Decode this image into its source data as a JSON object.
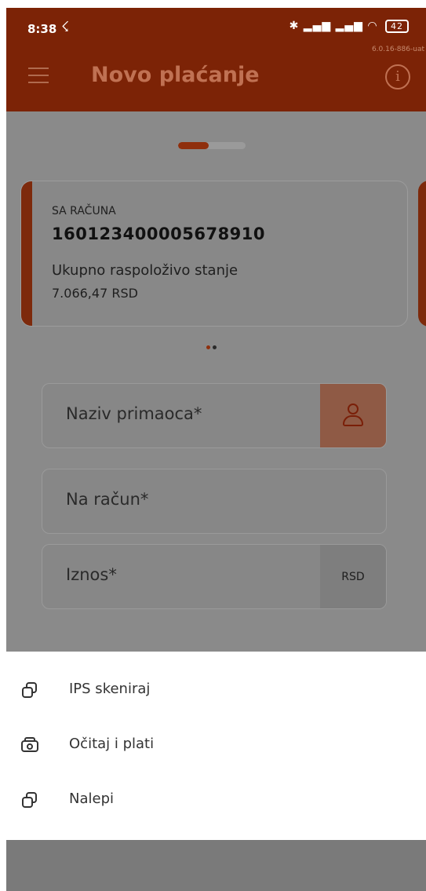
{
  "status_bar": {
    "time": "8:38",
    "battery": "42",
    "version": "6.0.16-886-uat"
  },
  "app_bar": {
    "title": "Novo plaćanje",
    "info_glyph": "i",
    "menu_icon": "hamburger-icon",
    "info_icon": "info-icon"
  },
  "progress": {
    "step_fraction": 0.45
  },
  "account_card": {
    "label": "SA RAČUNA",
    "number": "160123400005678910",
    "balance_label": "Ukupno raspoloživo stanje",
    "balance": "7.066,47 RSD"
  },
  "carousel": {
    "pages": 2,
    "active": 0
  },
  "form": {
    "recipient": {
      "label": "Naziv primaoca*",
      "icon": "contact-icon"
    },
    "account": {
      "label": "Na račun*"
    },
    "amount": {
      "label": "Iznos*",
      "currency": "RSD"
    }
  },
  "sheet": {
    "items": [
      {
        "label": "IPS skeniraj",
        "icon": "copy-icon"
      },
      {
        "label": "Očitaj i plati",
        "icon": "camera-icon"
      },
      {
        "label": "Nalepi",
        "icon": "copy-icon"
      }
    ]
  },
  "colors": {
    "brand": "#7c2306",
    "accent": "#e8501f",
    "overlay": "#8a8a8a",
    "sheet": "#ffffff"
  }
}
